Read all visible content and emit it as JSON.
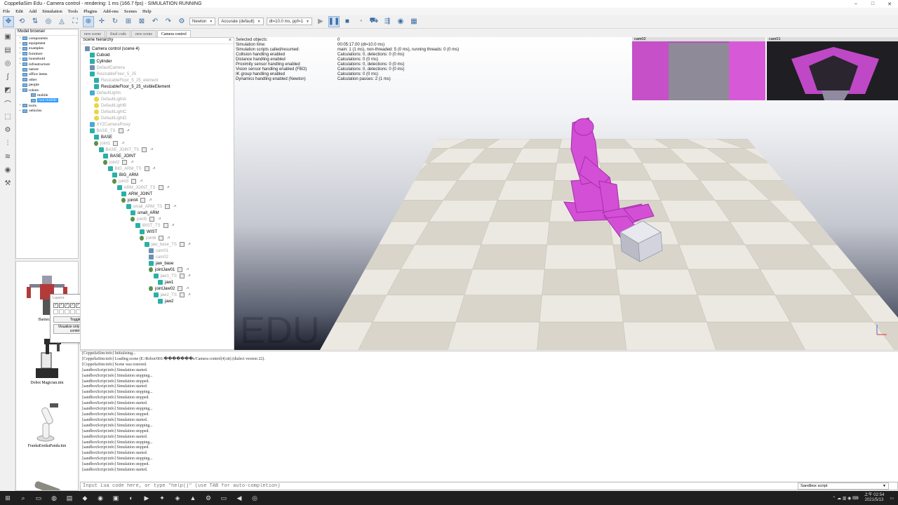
{
  "window": {
    "title": "CoppeliaSim Edu - Camera control - rendering: 1 ms (166.7 fps) - SIMULATION RUNNING",
    "controls": [
      "–",
      "□",
      "✕"
    ]
  },
  "menu": [
    "File",
    "Edit",
    "Add",
    "Simulation",
    "Tools",
    "Plugins",
    "Add-ons",
    "Scenes",
    "Help"
  ],
  "toolbar": {
    "engine_select": "Newton",
    "accuracy_select": "Accurate (default)",
    "dt_select": "dt=10.0 ms, ppf=1"
  },
  "model_browser": {
    "title": "Model browser",
    "items": [
      {
        "label": "components",
        "expander": "+",
        "depth": 0
      },
      {
        "label": "equipment",
        "expander": "+",
        "depth": 0
      },
      {
        "label": "examples",
        "expander": "+",
        "depth": 0
      },
      {
        "label": "furniture",
        "expander": "+",
        "depth": 0
      },
      {
        "label": "household",
        "expander": "+",
        "depth": 0
      },
      {
        "label": "infrastructure",
        "expander": "+",
        "depth": 0
      },
      {
        "label": "nature",
        "expander": "",
        "depth": 0
      },
      {
        "label": "office items",
        "expander": "",
        "depth": 0
      },
      {
        "label": "other",
        "expander": "",
        "depth": 0
      },
      {
        "label": "people",
        "expander": "",
        "depth": 0
      },
      {
        "label": "robots",
        "expander": "−",
        "depth": 0
      },
      {
        "label": "mobile",
        "expander": "",
        "depth": 1
      },
      {
        "label": "non-mobile",
        "expander": "",
        "depth": 1,
        "selected": true
      },
      {
        "label": "tools",
        "expander": "+",
        "depth": 0
      },
      {
        "label": "vehicles",
        "expander": "+",
        "depth": 0
      }
    ]
  },
  "thumbnails": [
    {
      "caption": "Baxter.ttm"
    },
    {
      "caption": "Dobot Magician.ttm"
    },
    {
      "caption": "FrankaEmikaPanda.ttm"
    },
    {
      "caption": ""
    }
  ],
  "layers_popup": {
    "title": "Layers",
    "toggle_label": "Toggle",
    "visualize_label": "Visualize only dynamic content"
  },
  "scene_tabs": [
    "new scene",
    "final code",
    "new scene",
    "Camera control"
  ],
  "hierarchy": {
    "title": "Scene hierarchy",
    "items": [
      {
        "label": "Camera control (scene 4)",
        "depth": 0,
        "icon": "cam",
        "dim": false
      },
      {
        "label": "Cuboid",
        "depth": 1,
        "icon": "shape",
        "dim": false
      },
      {
        "label": "Cylinder",
        "depth": 1,
        "icon": "shape",
        "dim": false
      },
      {
        "label": "DefaultCamera",
        "depth": 1,
        "icon": "cam",
        "dim": true
      },
      {
        "label": "ResizableFloor_5_25",
        "depth": 1,
        "icon": "shape",
        "dim": true
      },
      {
        "label": "ResizableFloor_5_25_element",
        "depth": 2,
        "icon": "shape",
        "dim": true
      },
      {
        "label": "ResizableFloor_5_25_visibleElement",
        "depth": 2,
        "icon": "shape",
        "dim": false
      },
      {
        "label": "DefaultLights",
        "depth": 1,
        "icon": "dummy",
        "dim": true
      },
      {
        "label": "DefaultLightA",
        "depth": 2,
        "icon": "light",
        "dim": true
      },
      {
        "label": "DefaultLightB",
        "depth": 2,
        "icon": "light",
        "dim": true
      },
      {
        "label": "DefaultLightC",
        "depth": 2,
        "icon": "light",
        "dim": true
      },
      {
        "label": "DefaultLightD",
        "depth": 2,
        "icon": "light",
        "dim": true
      },
      {
        "label": "XYZCameraProxy",
        "depth": 1,
        "icon": "dummy",
        "dim": true
      },
      {
        "label": "BASE_TS",
        "depth": 1,
        "icon": "shape",
        "dim": true
      },
      {
        "label": "BASE",
        "depth": 2,
        "icon": "shape",
        "dim": false
      },
      {
        "label": "joint1",
        "depth": 2,
        "icon": "joint",
        "dim": true
      },
      {
        "label": "BASE_JOINT_TS",
        "depth": 3,
        "icon": "shape",
        "dim": true
      },
      {
        "label": "BASE_JOINT",
        "depth": 4,
        "icon": "shape",
        "dim": false
      },
      {
        "label": "joint2",
        "depth": 4,
        "icon": "joint",
        "dim": true
      },
      {
        "label": "BIG_ARM_TS",
        "depth": 5,
        "icon": "shape",
        "dim": true
      },
      {
        "label": "BIG_ARM",
        "depth": 6,
        "icon": "shape",
        "dim": false
      },
      {
        "label": "joint3",
        "depth": 6,
        "icon": "joint",
        "dim": true
      },
      {
        "label": "ARM_JOINT_TS",
        "depth": 7,
        "icon": "shape",
        "dim": true
      },
      {
        "label": "ARM_JOINT",
        "depth": 8,
        "icon": "shape",
        "dim": false
      },
      {
        "label": "joint4",
        "depth": 8,
        "icon": "joint",
        "dim": false
      },
      {
        "label": "small_ARM_TS",
        "depth": 9,
        "icon": "shape",
        "dim": true
      },
      {
        "label": "small_ARM",
        "depth": 10,
        "icon": "shape",
        "dim": false
      },
      {
        "label": "joint5",
        "depth": 10,
        "icon": "joint",
        "dim": true
      },
      {
        "label": "WIST_TS",
        "depth": 11,
        "icon": "shape",
        "dim": true
      },
      {
        "label": "WIST",
        "depth": 12,
        "icon": "shape",
        "dim": false
      },
      {
        "label": "joint6",
        "depth": 12,
        "icon": "joint",
        "dim": true
      },
      {
        "label": "jaw_base_TS",
        "depth": 13,
        "icon": "shape",
        "dim": true
      },
      {
        "label": "cam01",
        "depth": 14,
        "icon": "cam",
        "dim": true
      },
      {
        "label": "cam02",
        "depth": 14,
        "icon": "cam",
        "dim": true
      },
      {
        "label": "jaw_base",
        "depth": 14,
        "icon": "shape",
        "dim": false
      },
      {
        "label": "jointJaw01",
        "depth": 14,
        "icon": "joint",
        "dim": false
      },
      {
        "label": "jaw1_TS",
        "depth": 15,
        "icon": "shape",
        "dim": true
      },
      {
        "label": "jaw1",
        "depth": 16,
        "icon": "shape",
        "dim": false
      },
      {
        "label": "jointJaw02",
        "depth": 14,
        "icon": "joint",
        "dim": false
      },
      {
        "label": "jaw2_TS",
        "depth": 15,
        "icon": "shape",
        "dim": true
      },
      {
        "label": "jaw2",
        "depth": 16,
        "icon": "shape",
        "dim": false
      }
    ]
  },
  "info_overlay": [
    {
      "k": "Selected objects:",
      "v": "0"
    },
    {
      "k": "Simulation time:",
      "v": "00:05:17.00 (dt=10.0 ms)"
    },
    {
      "k": "Simulation scripts called/resumed:",
      "v": "main: 1 (1 ms), non-threaded: 5 (0 ms), running threads: 0 (0 ms)"
    },
    {
      "k": "Collision handling enabled",
      "v": "Calculations: 0, detections: 0 (0 ms)"
    },
    {
      "k": "Distance handling enabled",
      "v": "Calculations: 0 (0 ms)"
    },
    {
      "k": "Proximity sensor handling enabled",
      "v": "Calculations: 0, detections: 0 (0 ms)"
    },
    {
      "k": "Vision sensor handling enabled (FBO)",
      "v": "Calculations: 0, detections: 0 (0 ms)"
    },
    {
      "k": "IK group handling enabled",
      "v": "Calculations: 0 (0 ms)"
    },
    {
      "k": "Dynamics handling enabled (Newton)",
      "v": "Calculation passes: 2 (1 ms)"
    }
  ],
  "cameras": {
    "cam_left": "cam02",
    "cam_right": "cam01"
  },
  "watermark": "EDU",
  "console": {
    "lines": [
      "[CoppeliaSim:info] Initializing...",
      "[CoppeliaSim:info] Loading scene (E:/Robot/001/�������s/Camera control(4).ttt) (dialect version 22).",
      "[CoppeliaSim:info] Scene was restored.",
      "[sandboxScript:info] Simulation started.",
      "[sandboxScript:info] Simulation stopping...",
      "[sandboxScript:info] Simulation stopped.",
      "[sandboxScript:info] Simulation started.",
      "[sandboxScript:info] Simulation stopping...",
      "[sandboxScript:info] Simulation stopped.",
      "[sandboxScript:info] Simulation started.",
      "[sandboxScript:info] Simulation stopping...",
      "[sandboxScript:info] Simulation stopped.",
      "[sandboxScript:info] Simulation started.",
      "[sandboxScript:info] Simulation stopping...",
      "[sandboxScript:info] Simulation stopped.",
      "[sandboxScript:info] Simulation started.",
      "[sandboxScript:info] Simulation stopping...",
      "[sandboxScript:info] Simulation stopped.",
      "[sandboxScript:info] Simulation started.",
      "[sandboxScript:info] Simulation stopping...",
      "[sandboxScript:info] Simulation stopped.",
      "[sandboxScript:info] Simulation started."
    ],
    "placeholder": "Input Lua code here, or type \"help()\" (use TAB for auto-completion)",
    "script_select": "Sandbox script"
  },
  "taskbar": {
    "time": "上午 02:54",
    "date": "2021/5/13"
  },
  "colors": {
    "robot": "#d34fd6",
    "floor_light": "#ece9e2",
    "floor_dark": "#d9d5cb",
    "selection": "#3399ff"
  }
}
